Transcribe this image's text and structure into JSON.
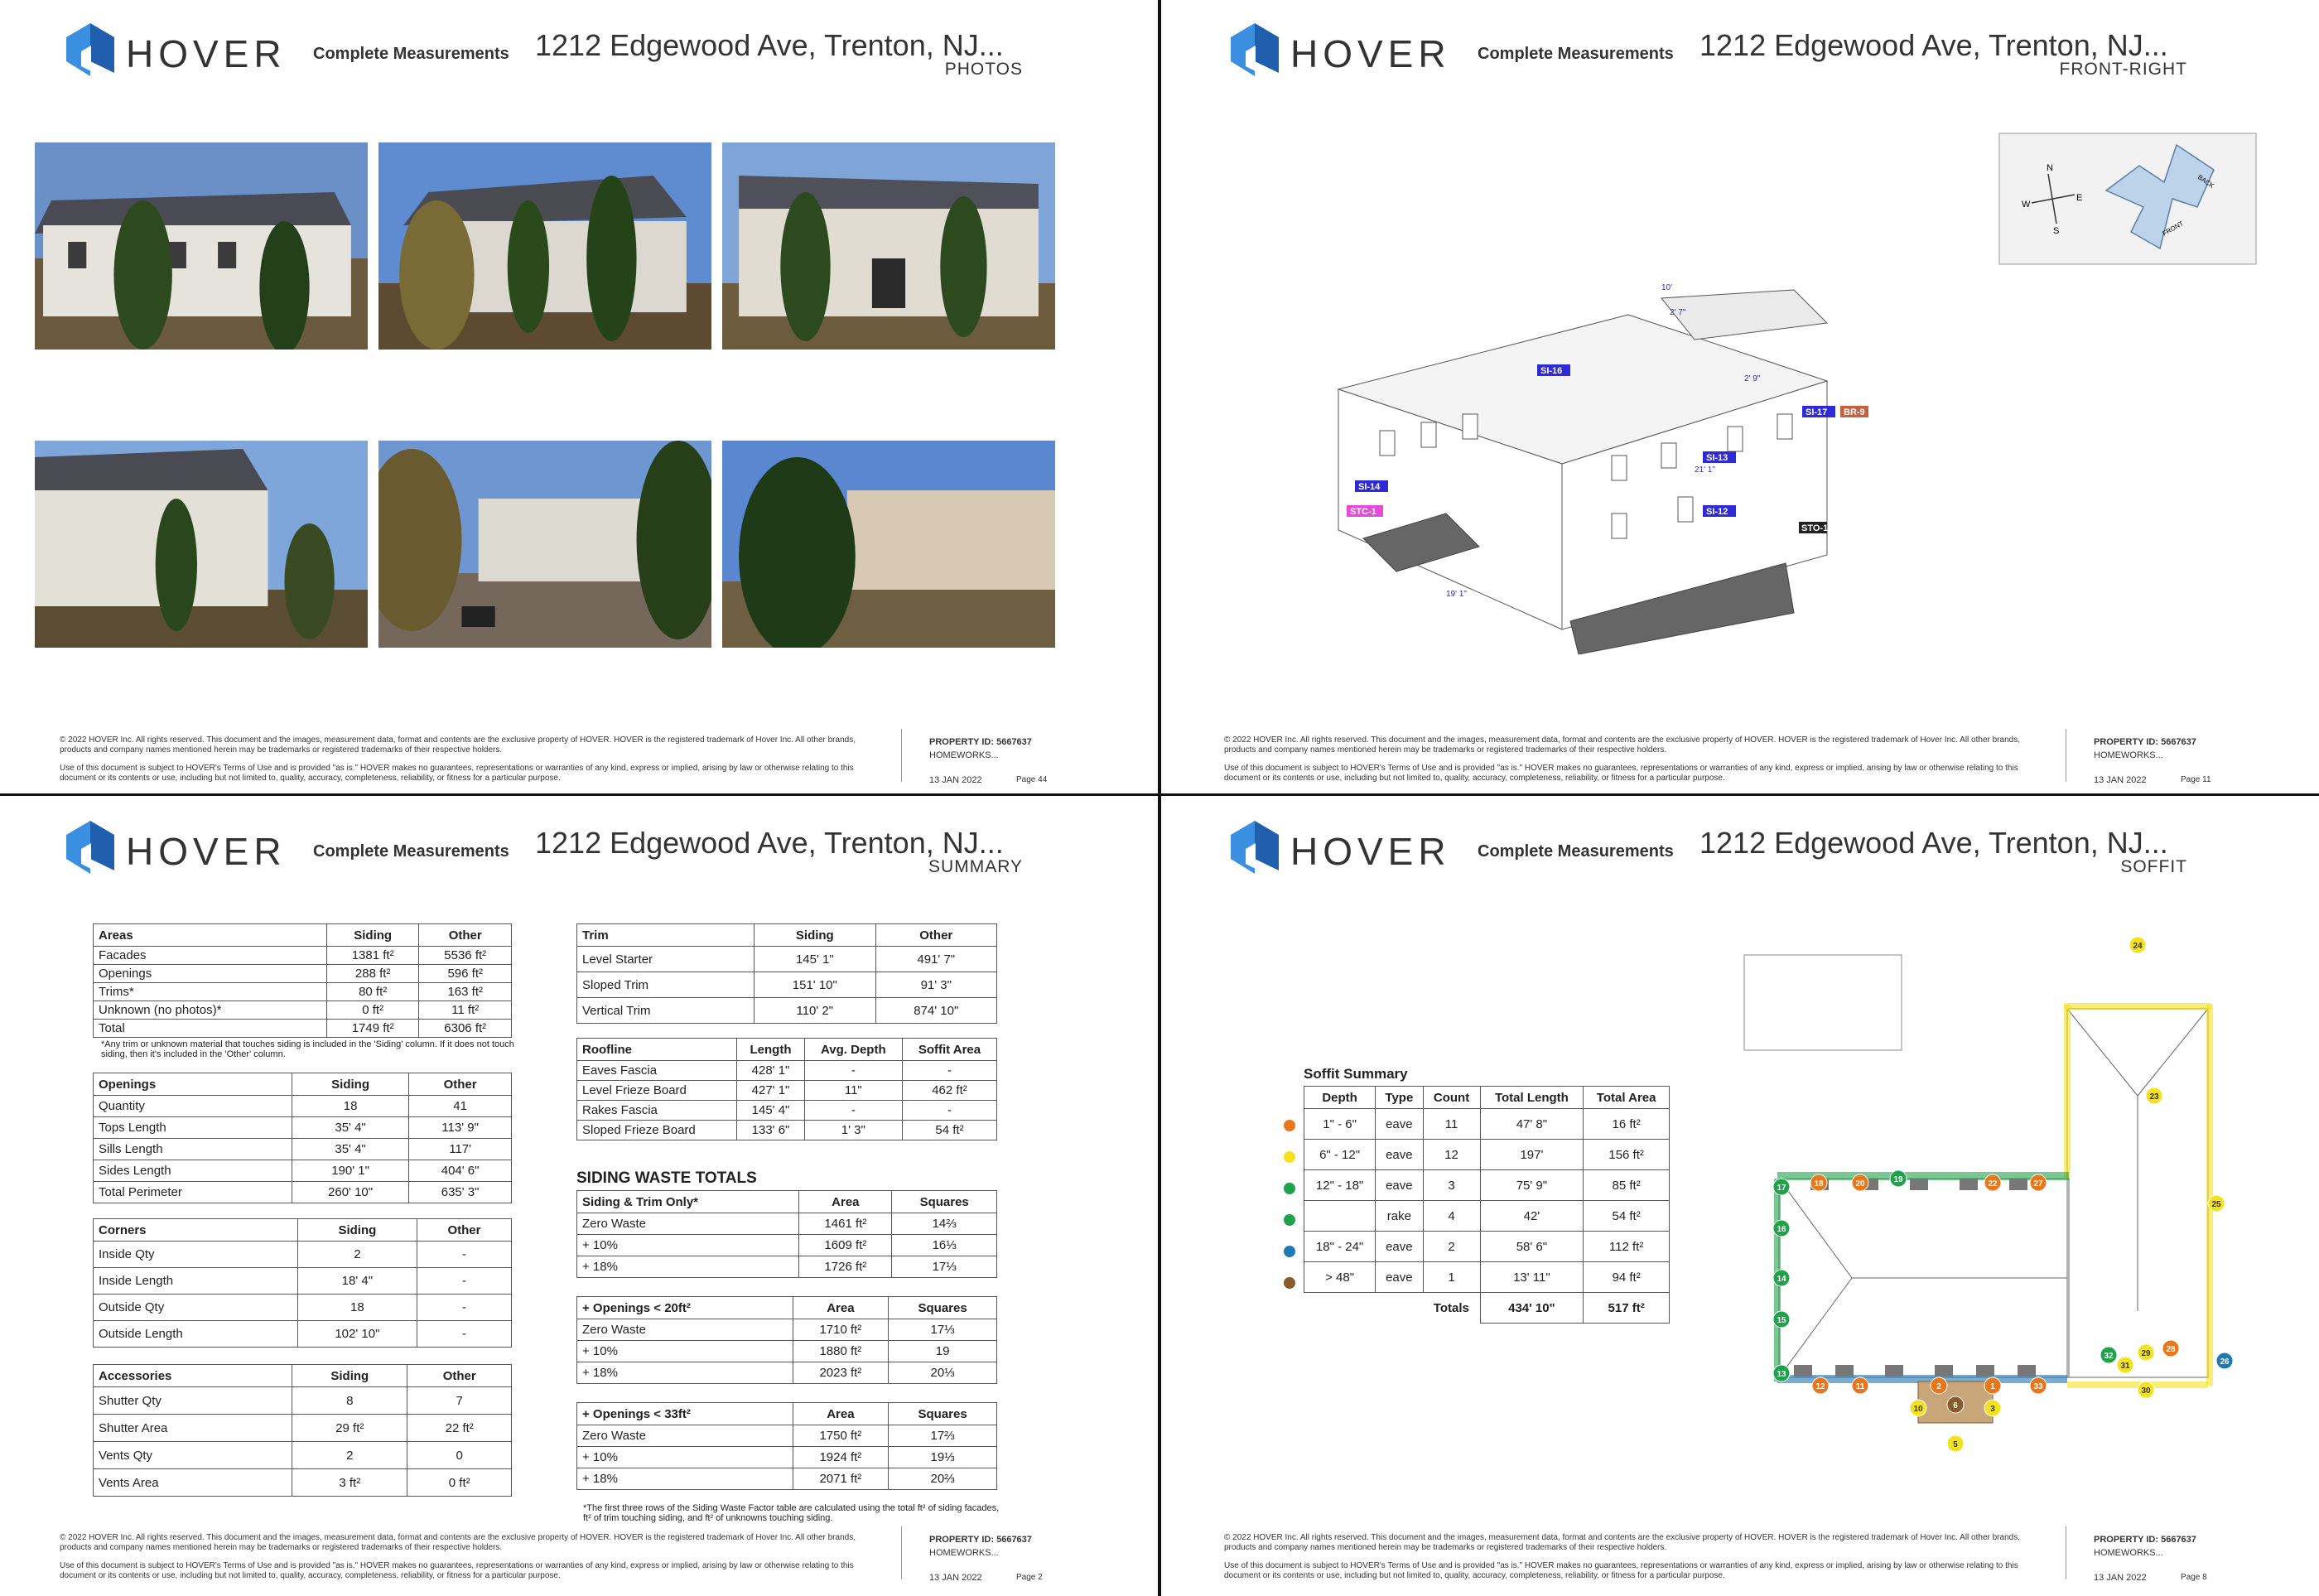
{
  "brand": "HOVER",
  "subtitle": "Complete Measurements",
  "address": "1212 Edgewood Ave, Trenton, NJ...",
  "footer": {
    "copyright": "© 2022 HOVER Inc. All rights reserved. This document and the images, measurement data, format and contents are the exclusive property of HOVER. HOVER is the registered trademark of Hover Inc. All other brands, products and company names mentioned herein may be trademarks or registered trademarks of their respective holders.",
    "terms": "Use of this document is subject to HOVER's Terms of Use and is provided \"as is.\" HOVER makes no guarantees, representations or warranties of any kind, express or implied, arising by law or otherwise relating to this document or its contents or use, including but not limited to, quality, accuracy, completeness, reliability, or fitness for a particular purpose.",
    "property_id": "PROPERTY ID: 5667637",
    "company": "HOMEWORKS...",
    "date": "13 JAN 2022"
  },
  "pages": [
    {
      "section": "PHOTOS",
      "page": "Page 44"
    },
    {
      "section": "FRONT-RIGHT",
      "page": "Page 11"
    },
    {
      "section": "SUMMARY",
      "page": "Page 2"
    },
    {
      "section": "SOFFIT",
      "page": "Page 8"
    }
  ],
  "front_right": {
    "compass": {
      "n": "N",
      "s": "S",
      "e": "E",
      "w": "W"
    },
    "roof_labels": {
      "back": "BACK",
      "front": "FRONT"
    },
    "labels": [
      "SI-16",
      "SI-14",
      "SI-17",
      "SI-13",
      "SI-12",
      "STC-1",
      "BR-9",
      "STO-1",
      "21' 1\"",
      "10'",
      "2' 9\"",
      "2' 7\"",
      "19' 1\""
    ]
  },
  "summary": {
    "areas": {
      "header": [
        "Areas",
        "Siding",
        "Other"
      ],
      "rows": [
        [
          "Facades",
          "1381 ft²",
          "5536 ft²"
        ],
        [
          "Openings",
          "288 ft²",
          "596 ft²"
        ],
        [
          "Trims*",
          "80 ft²",
          "163 ft²"
        ],
        [
          "Unknown (no photos)*",
          "0 ft²",
          "11 ft²"
        ],
        [
          "Total",
          "1749 ft²",
          "6306 ft²"
        ]
      ]
    },
    "areas_note": "*Any trim or unknown material that touches siding is included in the 'Siding' column. If it does not touch siding, then it's included in the 'Other' column.",
    "openings": {
      "header": [
        "Openings",
        "Siding",
        "Other"
      ],
      "rows": [
        [
          "Quantity",
          "18",
          "41"
        ],
        [
          "Tops Length",
          "35' 4\"",
          "113' 9\""
        ],
        [
          "Sills Length",
          "35' 4\"",
          "117'"
        ],
        [
          "Sides Length",
          "190' 1\"",
          "404' 6\""
        ],
        [
          "Total Perimeter",
          "260' 10\"",
          "635' 3\""
        ]
      ]
    },
    "corners": {
      "header": [
        "Corners",
        "Siding",
        "Other"
      ],
      "rows": [
        [
          "Inside Qty",
          "2",
          "-"
        ],
        [
          "Inside Length",
          "18' 4\"",
          "-"
        ],
        [
          "Outside Qty",
          "18",
          "-"
        ],
        [
          "Outside Length",
          "102' 10\"",
          "-"
        ]
      ]
    },
    "accessories": {
      "header": [
        "Accessories",
        "Siding",
        "Other"
      ],
      "rows": [
        [
          "Shutter Qty",
          "8",
          "7"
        ],
        [
          "Shutter Area",
          "29 ft²",
          "22 ft²"
        ],
        [
          "Vents Qty",
          "2",
          "0"
        ],
        [
          "Vents Area",
          "3 ft²",
          "0 ft²"
        ]
      ]
    },
    "trim": {
      "header": [
        "Trim",
        "Siding",
        "Other"
      ],
      "rows": [
        [
          "Level Starter",
          "145' 1\"",
          "491' 7\""
        ],
        [
          "Sloped Trim",
          "151' 10\"",
          "91' 3\""
        ],
        [
          "Vertical Trim",
          "110' 2\"",
          "874' 10\""
        ]
      ]
    },
    "roofline": {
      "header": [
        "Roofline",
        "Length",
        "Avg. Depth",
        "Soffit Area"
      ],
      "rows": [
        [
          "Eaves Fascia",
          "428' 1\"",
          "-",
          "-"
        ],
        [
          "Level Frieze Board",
          "427' 1\"",
          "11\"",
          "462 ft²"
        ],
        [
          "Rakes Fascia",
          "145' 4\"",
          "-",
          "-"
        ],
        [
          "Sloped Frieze Board",
          "133' 6\"",
          "1' 3\"",
          "54 ft²"
        ]
      ]
    },
    "waste_title": "SIDING WASTE TOTALS",
    "waste1": {
      "header": [
        "Siding & Trim Only*",
        "Area",
        "Squares"
      ],
      "rows": [
        [
          "Zero Waste",
          "1461 ft²",
          "14⅔"
        ],
        [
          "+ 10%",
          "1609 ft²",
          "16⅓"
        ],
        [
          "+ 18%",
          "1726 ft²",
          "17⅓"
        ]
      ]
    },
    "waste2": {
      "header": [
        "+ Openings < 20ft²",
        "Area",
        "Squares"
      ],
      "rows": [
        [
          "Zero Waste",
          "1710 ft²",
          "17⅓"
        ],
        [
          "+ 10%",
          "1880 ft²",
          "19"
        ],
        [
          "+ 18%",
          "2023 ft²",
          "20⅓"
        ]
      ]
    },
    "waste3": {
      "header": [
        "+ Openings < 33ft²",
        "Area",
        "Squares"
      ],
      "rows": [
        [
          "Zero Waste",
          "1750 ft²",
          "17⅔"
        ],
        [
          "+ 10%",
          "1924 ft²",
          "19⅓"
        ],
        [
          "+ 18%",
          "2071 ft²",
          "20⅔"
        ]
      ]
    },
    "waste_note": "*The first three rows of the Siding Waste Factor table are calculated using the total ft² of siding facades, ft² of trim touching siding, and ft² of unknowns touching siding."
  },
  "soffit": {
    "title": "Soffit Summary",
    "header": [
      "Depth",
      "Type",
      "Count",
      "Total Length",
      "Total Area"
    ],
    "rows": [
      {
        "color": "#e8771c",
        "cells": [
          "1\" - 6\"",
          "eave",
          "11",
          "47' 8\"",
          "16 ft²"
        ]
      },
      {
        "color": "#f3e21d",
        "cells": [
          "6\" - 12\"",
          "eave",
          "12",
          "197'",
          "156 ft²"
        ]
      },
      {
        "color": "#1fa34a",
        "cells": [
          "12\" - 18\"",
          "eave",
          "3",
          "75' 9\"",
          "85 ft²"
        ]
      },
      {
        "color": "#1fa34a",
        "cells": [
          "",
          "rake",
          "4",
          "42'",
          "54 ft²"
        ]
      },
      {
        "color": "#1f78b4",
        "cells": [
          "18\" - 24\"",
          "eave",
          "2",
          "58' 6\"",
          "112 ft²"
        ]
      },
      {
        "color": "#8b5a2b",
        "cells": [
          "> 48\"",
          "eave",
          "1",
          "13' 11\"",
          "94 ft²"
        ]
      }
    ],
    "totals": [
      "Totals",
      "434' 10\"",
      "517 ft²"
    ],
    "markers": [
      {
        "n": "24",
        "c": "#f3e21d"
      },
      {
        "n": "23",
        "c": "#f3e21d"
      },
      {
        "n": "25",
        "c": "#f3e21d"
      },
      {
        "n": "17",
        "c": "#1fa34a"
      },
      {
        "n": "18",
        "c": "#e8771c"
      },
      {
        "n": "20",
        "c": "#e8771c"
      },
      {
        "n": "19",
        "c": "#1fa34a"
      },
      {
        "n": "22",
        "c": "#e8771c"
      },
      {
        "n": "27",
        "c": "#e8771c"
      },
      {
        "n": "16",
        "c": "#1fa34a"
      },
      {
        "n": "14",
        "c": "#1fa34a"
      },
      {
        "n": "15",
        "c": "#1fa34a"
      },
      {
        "n": "13",
        "c": "#1fa34a"
      },
      {
        "n": "12",
        "c": "#e8771c"
      },
      {
        "n": "11",
        "c": "#e8771c"
      },
      {
        "n": "2",
        "c": "#e8771c"
      },
      {
        "n": "1",
        "c": "#e8771c"
      },
      {
        "n": "33",
        "c": "#e8771c"
      },
      {
        "n": "32",
        "c": "#1fa34a"
      },
      {
        "n": "31",
        "c": "#f3e21d"
      },
      {
        "n": "29",
        "c": "#f3e21d"
      },
      {
        "n": "28",
        "c": "#e8771c"
      },
      {
        "n": "26",
        "c": "#1f78b4"
      },
      {
        "n": "30",
        "c": "#f3e21d"
      },
      {
        "n": "10",
        "c": "#f3e21d"
      },
      {
        "n": "6",
        "c": "#8b5a2b"
      },
      {
        "n": "3",
        "c": "#f3e21d"
      },
      {
        "n": "5",
        "c": "#f3e21d"
      }
    ]
  }
}
